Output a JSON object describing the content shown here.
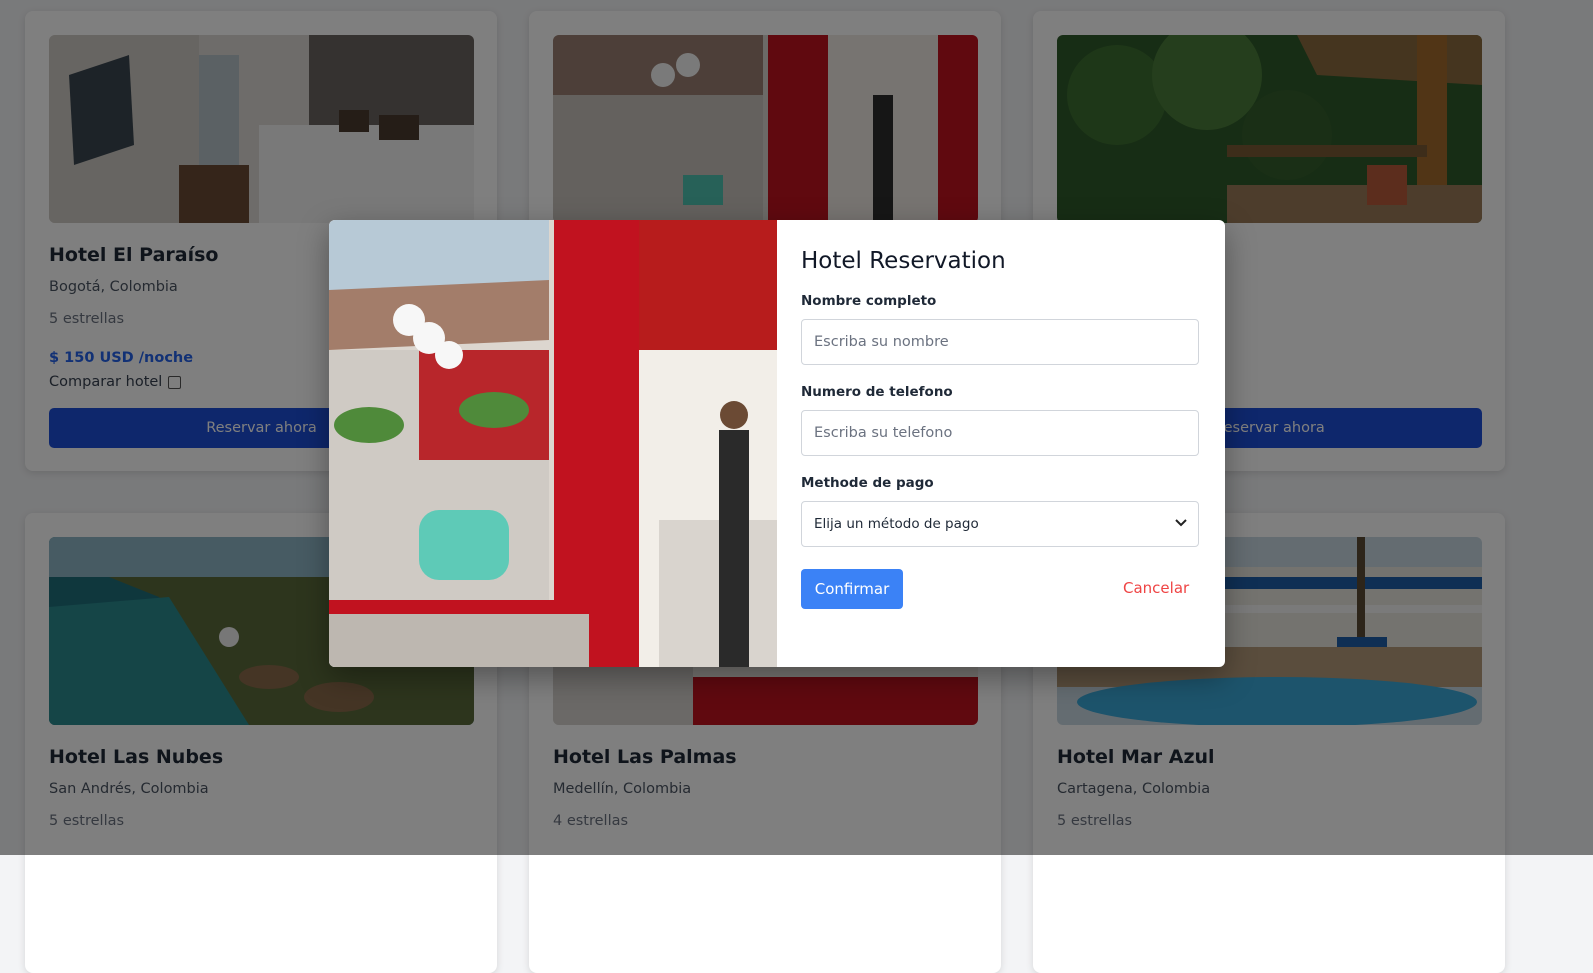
{
  "hotels": [
    {
      "name": "Hotel El Paraíso",
      "location": "Bogotá, Colombia",
      "rating": "5 estrellas",
      "price": "$ 150 USD /noche",
      "compare_label": "Comparar hotel",
      "button_label": "Reservar ahora"
    },
    {
      "name": "",
      "location": "",
      "rating": "",
      "price": "",
      "compare_label": "",
      "button_label": ""
    },
    {
      "name": "",
      "location": "",
      "rating": "",
      "price": "",
      "compare_label": "",
      "button_label": "Reservar ahora"
    },
    {
      "name": "Hotel Las Nubes",
      "location": "San Andrés, Colombia",
      "rating": "5 estrellas"
    },
    {
      "name": "Hotel Las Palmas",
      "location": "Medellín, Colombia",
      "rating": "4 estrellas"
    },
    {
      "name": "Hotel Mar Azul",
      "location": "Cartagena, Colombia",
      "rating": "5 estrellas"
    }
  ],
  "modal": {
    "title": "Hotel Reservation",
    "name_label": "Nombre completo",
    "name_placeholder": "Escriba su nombre",
    "phone_label": "Numero de telefono",
    "phone_placeholder": "Escriba su telefono",
    "payment_label": "Methode de pago",
    "payment_selected": "Elija un método de pago",
    "confirm_label": "Confirmar",
    "cancel_label": "Cancelar"
  },
  "colors": {
    "primary_button": "#1d4ed8",
    "confirm_button": "#3b82f6",
    "price_text": "#2563eb",
    "cancel_text": "#ef4444"
  },
  "icons": {
    "select_chevron": "chevron-down-icon"
  }
}
